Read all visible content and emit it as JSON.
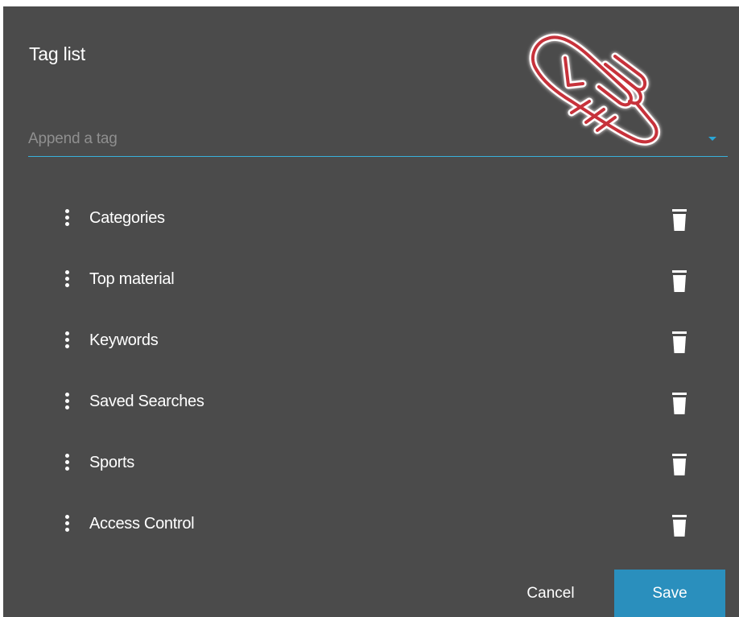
{
  "dialog": {
    "title": "Tag list"
  },
  "tag_select": {
    "placeholder": "Append a tag",
    "value": "",
    "accent_color": "#2aa6d6"
  },
  "tags": [
    {
      "label": "Categories"
    },
    {
      "label": "Top material"
    },
    {
      "label": "Keywords"
    },
    {
      "label": "Saved Searches"
    },
    {
      "label": "Sports"
    },
    {
      "label": "Access Control"
    }
  ],
  "footer": {
    "cancel_label": "Cancel",
    "save_label": "Save"
  },
  "colors": {
    "dialog_background": "#4b4b4b",
    "primary_button": "#2a8fbd",
    "pointer_outline": "#c7323a"
  },
  "icons": {
    "drag": "vertical-dots-icon",
    "delete": "trash-icon",
    "dropdown": "caret-down-icon",
    "cursor": "hand-pointer-icon"
  }
}
